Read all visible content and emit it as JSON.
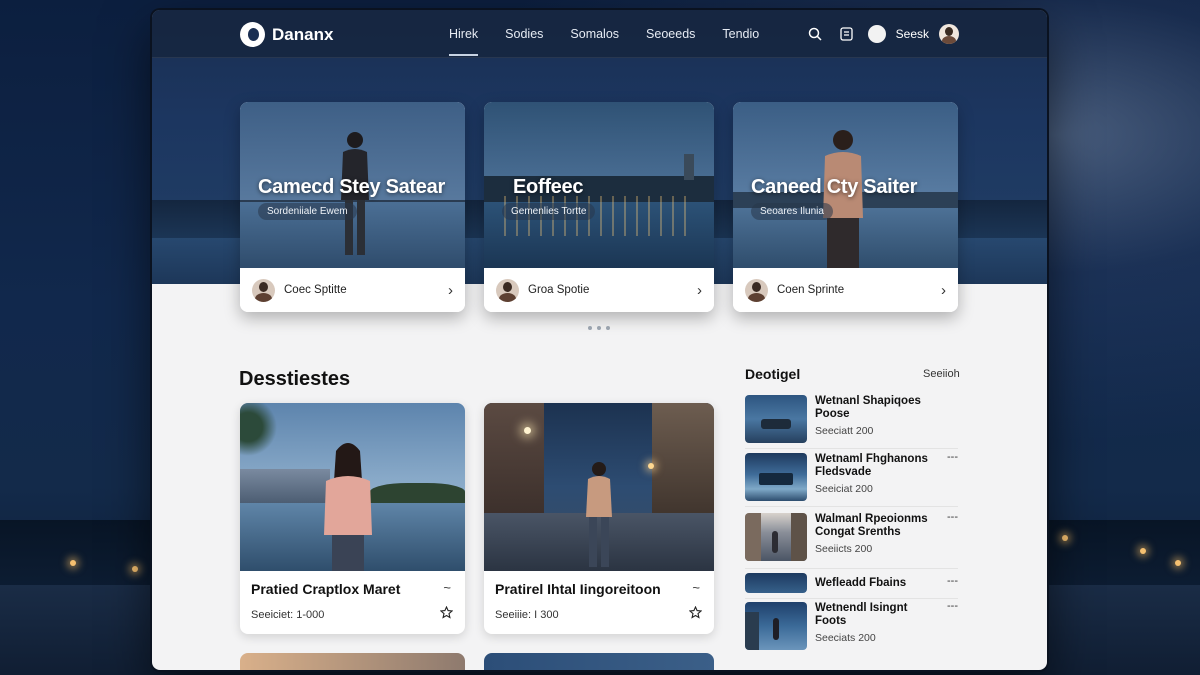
{
  "colors": {
    "nav_bg": "#16263f",
    "page_bg": "#f3f3f4",
    "night_sky": "#11284c",
    "text_dark": "#111111"
  },
  "brand": {
    "name": "Dananx",
    "logo_icon": "logo-circle-icon"
  },
  "nav": {
    "links": [
      "Hirek",
      "Sodies",
      "Somalos",
      "Seoeeds",
      "Tendio"
    ],
    "active_index": 0,
    "icons": [
      "search-icon",
      "bookmark-icon"
    ],
    "user_name": "Seesk"
  },
  "featured": [
    {
      "title": "Camecd Stey Satear",
      "tag": "Sordeniiale Ewem",
      "author": "Coec Sptitte"
    },
    {
      "title": "Eoffeec",
      "tag": "Gemenlies Tortte",
      "author": "Groa Spotie"
    },
    {
      "title": "Caneed Cty Saiter",
      "tag": "Seoares Ilunia",
      "author": "Coen Sprinte"
    }
  ],
  "carousel": {
    "dot_count": 3
  },
  "destinations": {
    "heading": "Desstiestes",
    "cards": [
      {
        "title": "Pratied Craptlox Maret",
        "meta": "Seeiciet: 1-000",
        "more": "~"
      },
      {
        "title": "Pratirel Ihtal Iingoreitoon",
        "meta": "Seeiiie: I 300",
        "more": "~"
      }
    ]
  },
  "sidebar": {
    "title": "Deotigel",
    "link": "Seeiioh",
    "items": [
      {
        "title": "Wetnanl Shapiqoes\nPoose",
        "meta": "Seeciatt 200",
        "dash": ""
      },
      {
        "title": "Wetnaml Fhghanons\nFledsvade",
        "meta": "Seeiciat 200",
        "dash": "---"
      },
      {
        "title": "Walmanl Rpeoionms\nCongat Srenths",
        "meta": "Seeiicts 200",
        "dash": "---"
      },
      {
        "title": "Wefleadd Fbains",
        "meta": "",
        "dash": "---"
      },
      {
        "title": "Wetnendl Isingnt\nFoots",
        "meta": "Seeciats 200",
        "dash": "---"
      }
    ]
  }
}
